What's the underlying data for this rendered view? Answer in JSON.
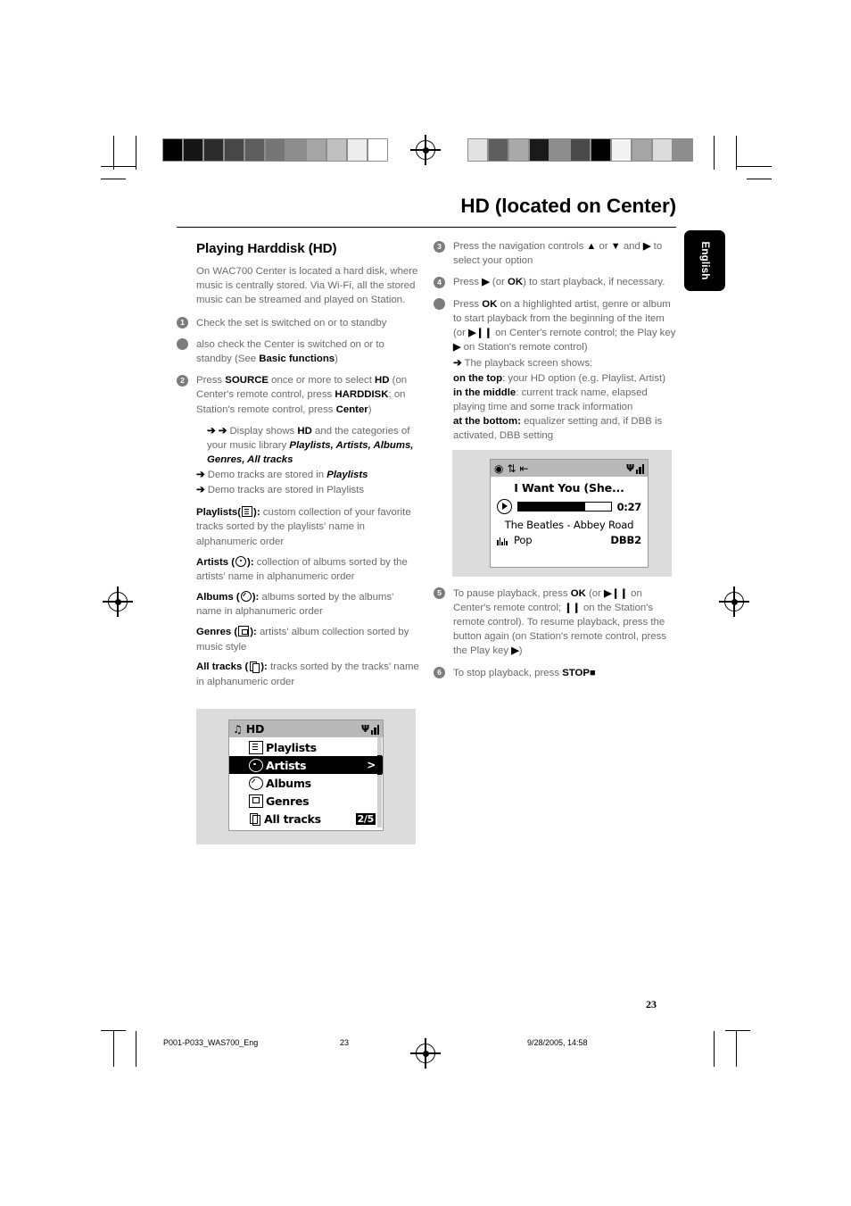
{
  "document": {
    "title": "HD (located on Center)",
    "language_tab": "English",
    "page_number": "23"
  },
  "footer": {
    "file_name": "P001-P033_WAS700_Eng",
    "page": "23",
    "timestamp": "9/28/2005, 14:58"
  },
  "left_column": {
    "section_heading": "Playing Harddisk (HD)",
    "intro_paragraph": "On WAC700 Center is located a hard disk, where music is centrally stored. Via Wi-Fi,  all the stored music can be streamed and played on Station.",
    "steps": [
      {
        "marker": "1",
        "marker_type": "number",
        "text": "Check the set is switched on or to standby"
      },
      {
        "marker": "",
        "marker_type": "dot",
        "text_1": "also check the Center is switched on or to standby (See ",
        "bold_1": "Basic functions",
        "text_2": ")"
      },
      {
        "marker": "2",
        "marker_type": "number",
        "text_1": "Press ",
        "bold_1": "SOURCE",
        "text_2": " once or more to select ",
        "bold_2": "HD",
        "text_3": " (on Center's remote control, press ",
        "bold_3": "HARDDISK",
        "text_4": "; on Station's remote control, press ",
        "bold_4": "Center",
        "text_5": ")"
      }
    ],
    "display_note": {
      "arrows": "➔ ➔",
      "text_1": "Display shows ",
      "bold_1": "HD",
      "text_2": " and the categories of your music library ",
      "italic_bold": "Playlists, Artists, Albums, Genres, All tracks"
    },
    "demo_notes": [
      {
        "arrow": "➔",
        "text": "Demo tracks are stored in ",
        "bold_italic": "Playlists"
      },
      {
        "arrow": "➔",
        "text": "Demo tracks are stored in Playlists",
        "bold_italic": ""
      }
    ],
    "definitions": [
      {
        "term": "Playlists(",
        "icon": "playlist-icon",
        "term_end": "):",
        "description": " custom collection of your favorite tracks sorted by the playlists' name in alphanumeric order"
      },
      {
        "term": "Artists (",
        "icon": "artist-icon",
        "term_end": "):",
        "description": " collection of albums sorted by the artists' name in alphanumeric order"
      },
      {
        "term": "Albums (",
        "icon": "album-icon",
        "term_end": "):",
        "description": " albums sorted by the albums' name in alphanumeric order"
      },
      {
        "term": "Genres (",
        "icon": "genre-icon",
        "term_end": "):",
        "description": " artists' album collection sorted by music style"
      },
      {
        "term": "All tracks (",
        "icon": "track-icon",
        "term_end": "):",
        "description": " tracks sorted by the tracks' name in alphanumeric order"
      }
    ]
  },
  "right_column": {
    "steps": [
      {
        "marker": "3",
        "marker_type": "number",
        "text_1": "Press the navigation controls ",
        "glyph_1": "▲",
        "text_2": " or ",
        "glyph_2": "▼",
        "text_3": " and ",
        "glyph_3": "▶",
        "text_4": " to select your option"
      },
      {
        "marker": "4",
        "marker_type": "number",
        "text_1": "Press ",
        "glyph_1": "▶",
        "text_2": " (or ",
        "bold_1": "OK",
        "text_3": ") to start playback, if necessary."
      },
      {
        "marker": "",
        "marker_type": "dot",
        "text_1": "Press ",
        "bold_1": "OK",
        "text_2": " on a highlighted artist, genre or album to start playback from the beginning of the item (or ",
        "glyph_1": "▶❙❙",
        "text_3": " on Center's remote control; the Play key ",
        "glyph_2": "▶",
        "text_4": " on Station's remote control)"
      },
      {
        "marker": "5",
        "marker_type": "number",
        "text_1": "To pause playback, press ",
        "bold_1": "OK",
        "text_2": " (or ",
        "glyph_1": "▶❙❙",
        "text_3": " on Center's remote control; ",
        "glyph_2": "❙❙",
        "text_4": " on the Station's remote control). To resume playback, press the button again (on Station's remote control, press the Play key ",
        "glyph_3": "▶",
        "text_5": ")"
      },
      {
        "marker": "6",
        "marker_type": "number",
        "text_1": "To stop playback, press ",
        "bold_1": "STOP",
        "glyph_1": "■"
      }
    ],
    "playback_screen_note": {
      "arrow": "➔",
      "lead": " The playback screen shows:",
      "lines": [
        {
          "bold": "on the top",
          "text": ": your HD option (e.g. Playlist, Artist)"
        },
        {
          "bold": "in the middle",
          "text": ": current track name, elapsed playing time and some track information"
        },
        {
          "bold": "at the bottom:",
          "text": " equalizer setting and, if DBB is activated, DBB setting"
        }
      ]
    }
  },
  "lcd_hd_menu": {
    "header_icon": "music-note-icon",
    "header_title": "HD",
    "signal_icon": "wifi-signal-icon",
    "items": [
      {
        "label": "Playlists",
        "icon": "playlist-icon",
        "selected": false
      },
      {
        "label": "Artists",
        "icon": "artist-icon",
        "selected": true,
        "chevron": ">"
      },
      {
        "label": "Albums",
        "icon": "album-icon",
        "selected": false
      },
      {
        "label": "Genres",
        "icon": "genre-icon",
        "selected": false
      },
      {
        "label": "All tracks",
        "icon": "track-icon",
        "selected": false
      }
    ],
    "page_indicator": "2/5"
  },
  "lcd_playback": {
    "header_icons": [
      "album-mode-icon",
      "shuffle-icon",
      "repeat-icon"
    ],
    "signal_icon": "wifi-signal-icon",
    "track_title": "I Want You (She...",
    "elapsed_time": "0:27",
    "progress_percent": 72,
    "artist_album": "The Beatles - Abbey Road",
    "genre": "Pop",
    "dbb_setting": "DBB2",
    "equalizer_icon": "equalizer-icon",
    "play_icon": "play-icon"
  },
  "calibration": {
    "left_bar": [
      "#000000",
      "#161616",
      "#2b2b2b",
      "#474747",
      "#5e5e5e",
      "#757575",
      "#8d8d8d",
      "#a5a5a5",
      "#c0c0c0",
      "#ededed",
      "#ffffff"
    ],
    "right_bar": [
      "#e2e2e2",
      "#5e5e5e",
      "#a9a9a9",
      "#1a1a1a",
      "#8d8d8d",
      "#4a4a4a",
      "#000000",
      "#f3f3f3",
      "#a5a5a5",
      "#dcdcdc",
      "#8d8d8d"
    ]
  }
}
